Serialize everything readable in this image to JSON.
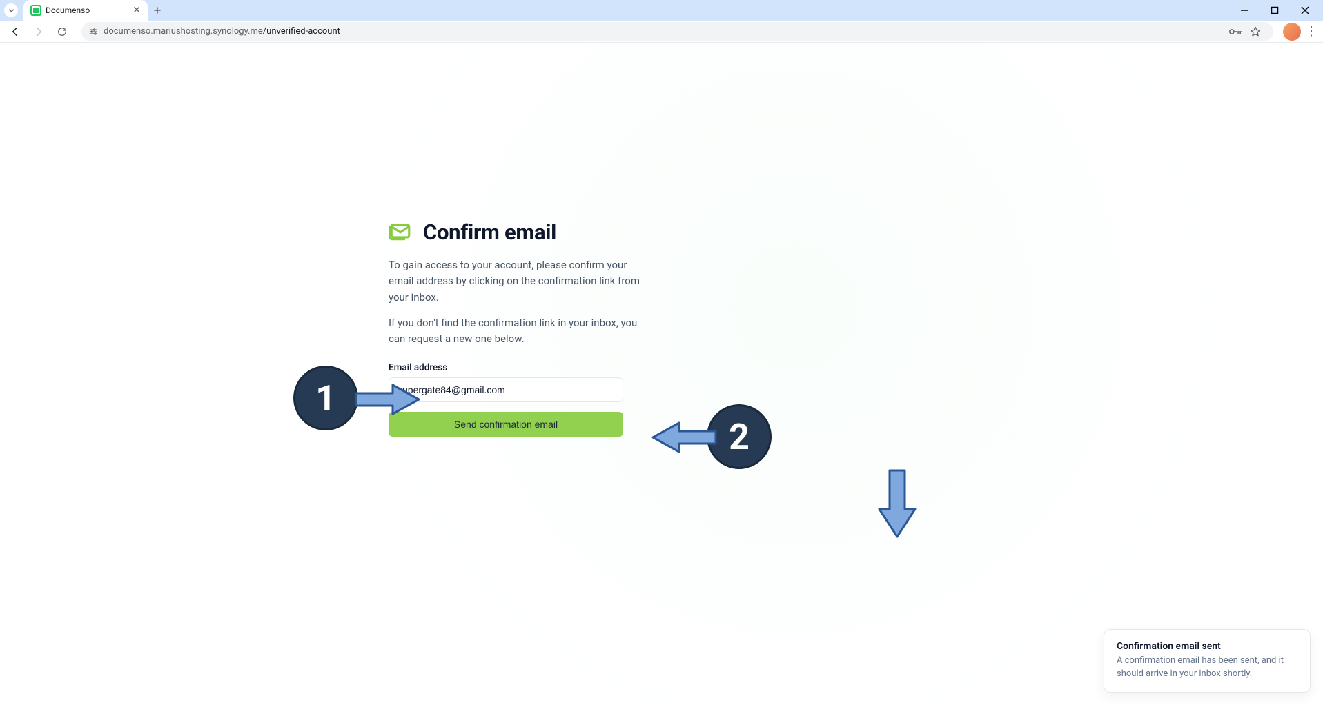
{
  "browser": {
    "tab_title": "Documenso",
    "url_host": "documenso.mariushosting.synology.me",
    "url_path": "/unverified-account"
  },
  "page": {
    "heading": "Confirm email",
    "paragraph1": "To gain access to your account, please confirm your email address by clicking on the confirmation link from your inbox.",
    "paragraph2": "If you don't find the confirmation link in your inbox, you can request a new one below.",
    "email_label": "Email address",
    "email_value": "supergate84@gmail.com",
    "submit_label": "Send confirmation email"
  },
  "annotations": {
    "badge1": "1",
    "badge2": "2"
  },
  "toast": {
    "title": "Confirmation email sent",
    "body": "A confirmation email has been sent, and it should arrive in your inbox shortly."
  }
}
